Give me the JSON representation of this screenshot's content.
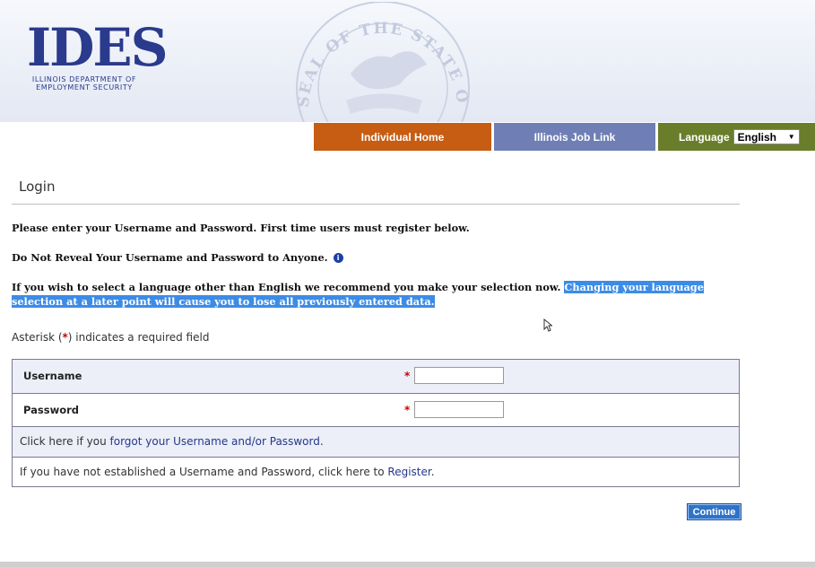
{
  "header": {
    "logo_text": "IDES",
    "logo_sub_line1": "ILLINOIS DEPARTMENT OF",
    "logo_sub_line2": "EMPLOYMENT SECURITY",
    "seal_text": "SEAL OF THE STATE OF ILLINOIS"
  },
  "nav": {
    "individual_home": "Individual Home",
    "job_link": "Illinois Job Link",
    "language_label": "Language",
    "language_selected": "English"
  },
  "login": {
    "title": "Login",
    "instruction": "Please enter your Username and Password. First time users must register below.",
    "warning": "Do Not Reveal Your Username and Password to Anyone.",
    "language_note": "If you wish to select a language other than English we recommend you make your selection now.",
    "language_warning": "Changing your language selection at a later point will cause you to lose all previously entered data.",
    "asterisk_prefix": "Asterisk (",
    "asterisk_symbol": "*",
    "asterisk_suffix": ") indicates a required field"
  },
  "form": {
    "username_label": "Username",
    "password_label": "Password",
    "required_mark": "*",
    "username_value": "",
    "password_value": "",
    "forgot_prefix": "Click here if you ",
    "forgot_link": "forgot your Username and/or Password",
    "forgot_suffix": ".",
    "register_prefix": "If you have not established a Username and Password, click here to ",
    "register_link": "Register",
    "register_suffix": "."
  },
  "actions": {
    "continue_label": "Continue"
  },
  "colors": {
    "nav_home": "#c65d12",
    "nav_job": "#6f7fb5",
    "nav_lang": "#6a7d2a",
    "brand_blue": "#2a3a8c",
    "highlight": "#3c8ce6",
    "required": "#cc0000"
  }
}
